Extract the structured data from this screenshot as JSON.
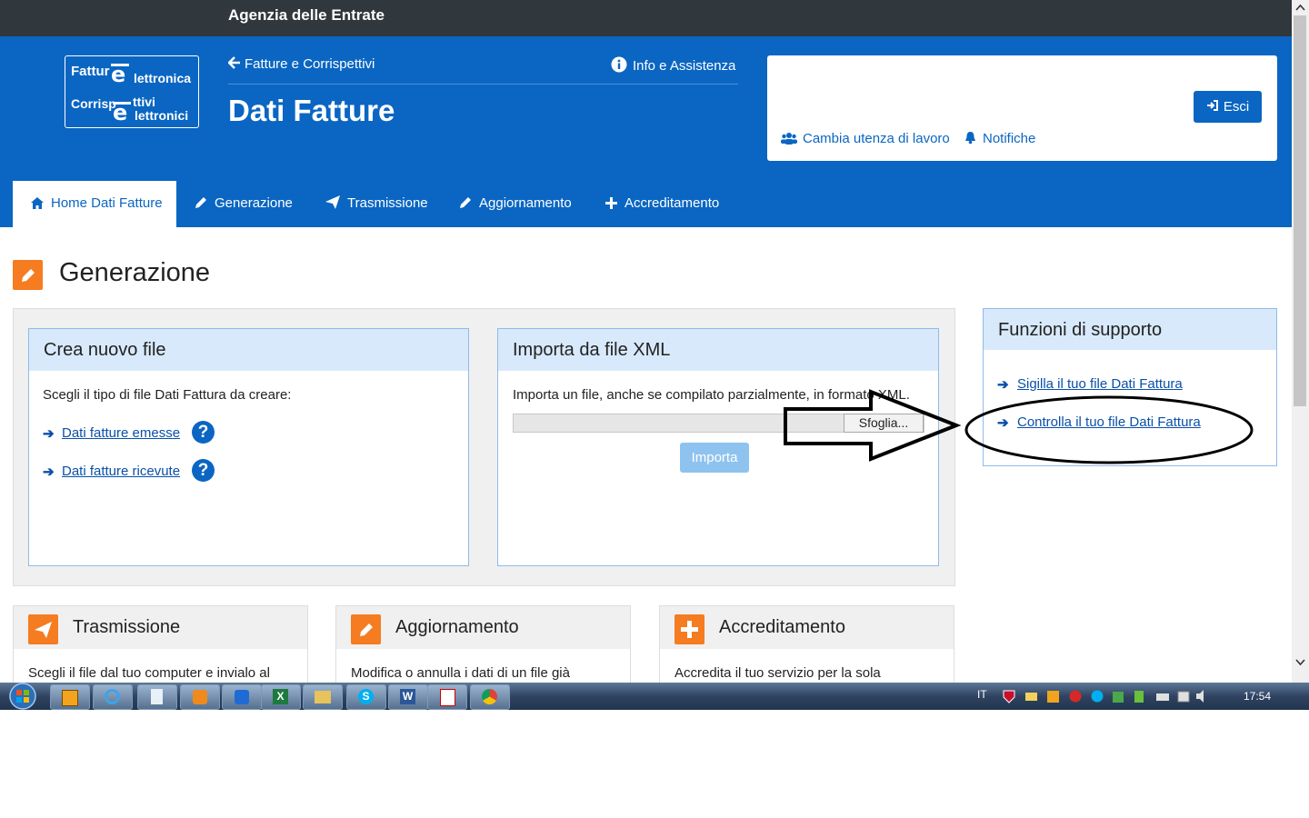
{
  "topbar": {
    "agency": "Agenzia delle Entrate"
  },
  "header": {
    "logo": {
      "line1": "Fattur",
      "line1b": "lettronica",
      "line2": "Corrisp",
      "line2b": "ttivi",
      "line3": "lettronici"
    },
    "back_link": "Fatture e Corrispettivi",
    "info_link": "Info e Assistenza",
    "page_title": "Dati Fatture",
    "esci_label": "Esci",
    "change_user": "Cambia utenza di lavoro",
    "notifications": "Notifiche"
  },
  "nav": {
    "items": [
      {
        "label": "Home Dati Fatture",
        "icon": "home-icon",
        "active": true
      },
      {
        "label": "Generazione",
        "icon": "pencil-icon"
      },
      {
        "label": "Trasmissione",
        "icon": "paper-plane-icon"
      },
      {
        "label": "Aggiornamento",
        "icon": "pencil-icon"
      },
      {
        "label": "Accreditamento",
        "icon": "plus-icon"
      }
    ]
  },
  "section": {
    "title": "Generazione",
    "icon": "pencil-icon"
  },
  "crea": {
    "title": "Crea nuovo file",
    "desc": "Scegli il tipo di file Dati Fattura da creare:",
    "link1": "Dati fatture emesse",
    "link2": "Dati fatture ricevute",
    "help": "?"
  },
  "importa": {
    "title": "Importa da file XML",
    "desc": "Importa un file, anche se compilato parzialmente, in formato XML.",
    "browse_label": "Sfoglia...",
    "import_label": "Importa"
  },
  "supporto": {
    "title": "Funzioni di supporto",
    "link1": "Sigilla il tuo file Dati Fattura",
    "link2": "Controlla il tuo file Dati Fattura"
  },
  "bottom_cards": [
    {
      "title": "Trasmissione",
      "desc": "Scegli il file dal tuo computer e invialo al",
      "icon": "paper-plane-icon"
    },
    {
      "title": "Aggiornamento",
      "desc": "Modifica o annulla i dati di un file già",
      "icon": "pencil-icon"
    },
    {
      "title": "Accreditamento",
      "desc": "Accredita il tuo servizio per la sola",
      "icon": "plus-icon"
    }
  ],
  "taskbar": {
    "lang": "IT",
    "time": "17:54"
  },
  "colors": {
    "brand_blue": "#0a66c2",
    "topbar": "#30373d",
    "accent_orange": "#f57c20"
  }
}
